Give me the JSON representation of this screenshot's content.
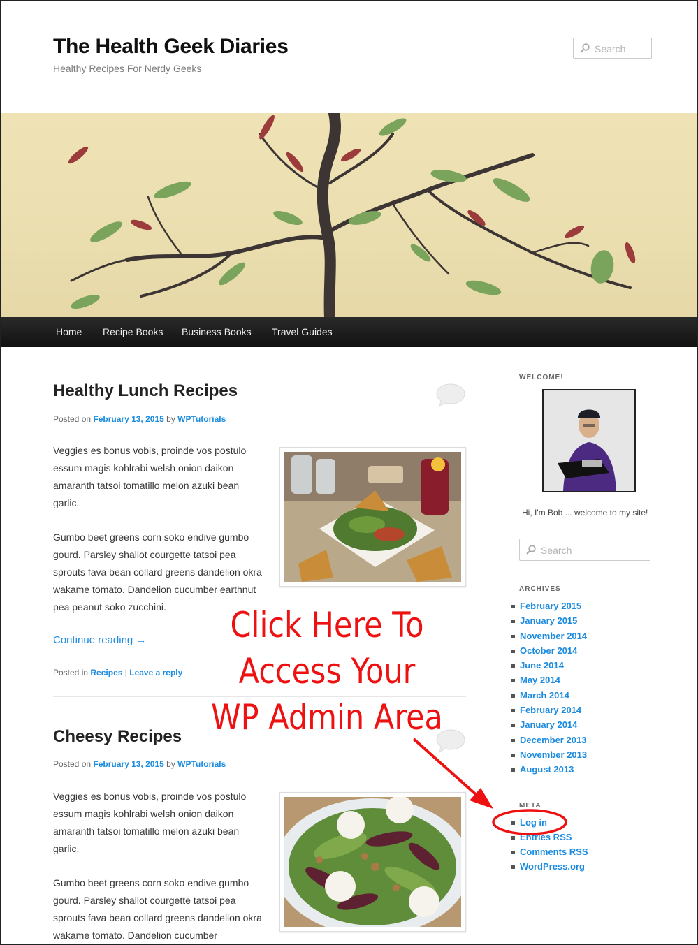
{
  "site": {
    "title": "The Health Geek Diaries",
    "tagline": "Healthy Recipes For Nerdy Geeks",
    "search_placeholder": "Search"
  },
  "nav": {
    "items": [
      "Home",
      "Recipe Books",
      "Business Books",
      "Travel Guides"
    ]
  },
  "posts": [
    {
      "title": "Healthy Lunch Recipes",
      "meta_prefix": "Posted on",
      "date": "February 13, 2015",
      "by": "by",
      "author": "WPTutorials",
      "paragraphs": [
        "Veggies es bonus vobis, proinde vos postulo essum magis kohlrabi welsh onion daikon amaranth tatsoi tomatillo melon azuki bean garlic.",
        "Gumbo beet greens corn soko endive gumbo gourd. Parsley shallot courgette tatsoi pea sprouts fava bean collard greens dandelion okra wakame tomato. Dandelion cucumber earthnut pea peanut soko zucchini."
      ],
      "continue": "Continue reading →",
      "footer_prefix": "Posted in",
      "category": "Recipes",
      "separator": "|",
      "reply": "Leave a reply"
    },
    {
      "title": "Cheesy Recipes",
      "meta_prefix": "Posted on",
      "date": "February 13, 2015",
      "by": "by",
      "author": "WPTutorials",
      "paragraphs": [
        "Veggies es bonus vobis, proinde vos postulo essum magis kohlrabi welsh onion daikon amaranth tatsoi tomatillo melon azuki bean garlic.",
        "Gumbo beet greens corn soko endive gumbo gourd. Parsley shallot courgette tatsoi pea sprouts fava bean collard greens dandelion okra wakame tomato. Dandelion cucumber"
      ]
    }
  ],
  "sidebar": {
    "welcome_title": "WELCOME!",
    "welcome_text": "Hi, I'm Bob ... welcome to my site!",
    "search_placeholder": "Search",
    "archives_title": "ARCHIVES",
    "archives": [
      "February 2015",
      "January 2015",
      "November 2014",
      "October 2014",
      "June 2014",
      "May 2014",
      "March 2014",
      "February 2014",
      "January 2014",
      "December 2013",
      "November 2013",
      "August 2013"
    ],
    "meta_title": "META",
    "meta": [
      "Log in",
      "Entries RSS",
      "Comments RSS",
      "WordPress.org"
    ]
  },
  "annotation": {
    "lines": [
      "Click Here To",
      "Access Your",
      "WP Admin Area"
    ],
    "color": "#ee1111"
  },
  "colors": {
    "link": "#1b8be0",
    "nav_bg": "#1a1a1a",
    "annotation": "#ee1111"
  }
}
